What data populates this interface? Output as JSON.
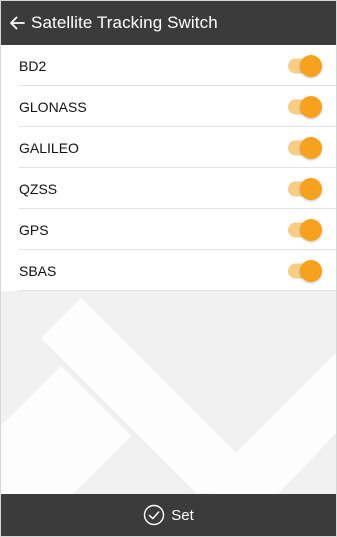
{
  "header": {
    "back_icon": "arrow-left-icon",
    "title": "Satellite Tracking Switch"
  },
  "satellites": [
    {
      "label": "BD2",
      "enabled": true
    },
    {
      "label": "GLONASS",
      "enabled": true
    },
    {
      "label": "GALILEO",
      "enabled": true
    },
    {
      "label": "QZSS",
      "enabled": true
    },
    {
      "label": "GPS",
      "enabled": true
    },
    {
      "label": "SBAS",
      "enabled": true
    }
  ],
  "footer": {
    "set_icon": "check-circle-icon",
    "set_label": "Set"
  },
  "colors": {
    "header_bg": "#3b3b3b",
    "toggle_on": "#f7a21e",
    "toggle_track": "#f8cd86"
  }
}
